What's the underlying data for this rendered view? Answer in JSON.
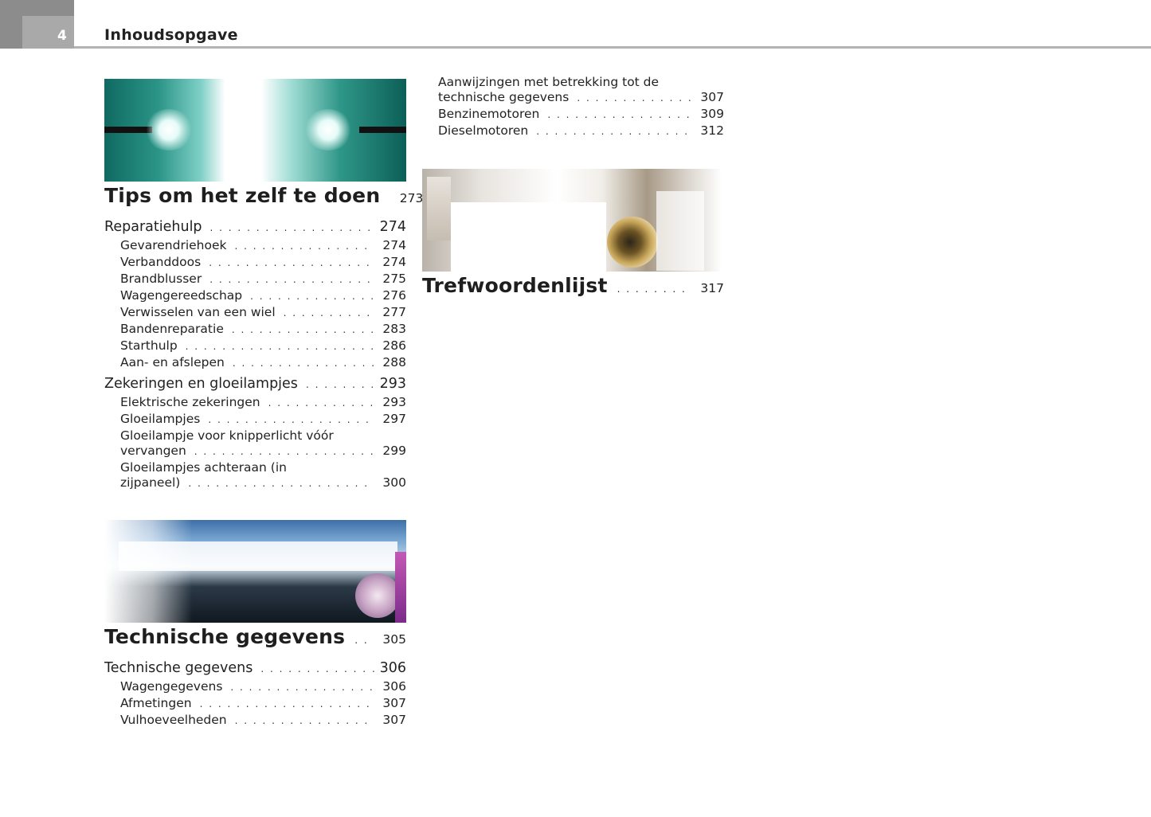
{
  "header": {
    "page_number": "4",
    "title": "Inhoudsopgave"
  },
  "images": {
    "bulbs": "lightbulbs-photo",
    "road": "road-speedometer-photo",
    "trumpet": "trumpet-photo"
  },
  "sections": {
    "tips": {
      "title": "Tips om het zelf te doen",
      "page": "273",
      "entries": [
        {
          "label": "Reparatiehulp",
          "page": "274"
        },
        {
          "label": "Gevarendriehoek",
          "page": "274"
        },
        {
          "label": "Verbanddoos",
          "page": "274"
        },
        {
          "label": "Brandblusser",
          "page": "275"
        },
        {
          "label": "Wagengereedschap",
          "page": "276"
        },
        {
          "label": "Verwisselen van een wiel",
          "page": "277"
        },
        {
          "label": "Bandenreparatie",
          "page": "283"
        },
        {
          "label": "Starthulp",
          "page": "286"
        },
        {
          "label": "Aan- en afslepen",
          "page": "288"
        },
        {
          "label": "Zekeringen en gloeilampjes",
          "page": "293"
        },
        {
          "label": "Elektrische zekeringen",
          "page": "293"
        },
        {
          "label": "Gloeilampjes",
          "page": "297"
        },
        {
          "label_line1": "Gloeilampje voor knipperlicht vóór",
          "label_line2": "vervangen",
          "page": "299"
        },
        {
          "label_line1": "Gloeilampjes achteraan (in",
          "label_line2": "zijpaneel)",
          "page": "300"
        }
      ]
    },
    "technisch": {
      "title": "Technische gegevens",
      "page": "305",
      "entries": [
        {
          "label": "Technische gegevens",
          "page": "306"
        },
        {
          "label": "Wagengegevens",
          "page": "306"
        },
        {
          "label": "Afmetingen",
          "page": "307"
        },
        {
          "label": "Vulhoeveelheden",
          "page": "307"
        },
        {
          "label_line1": "Aanwijzingen met betrekking tot de",
          "label_line2": "technische gegevens",
          "page": "307"
        },
        {
          "label": "Benzinemotoren",
          "page": "309"
        },
        {
          "label": "Dieselmotoren",
          "page": "312"
        }
      ]
    },
    "index": {
      "title": "Trefwoordenlijst",
      "page": "317"
    }
  }
}
